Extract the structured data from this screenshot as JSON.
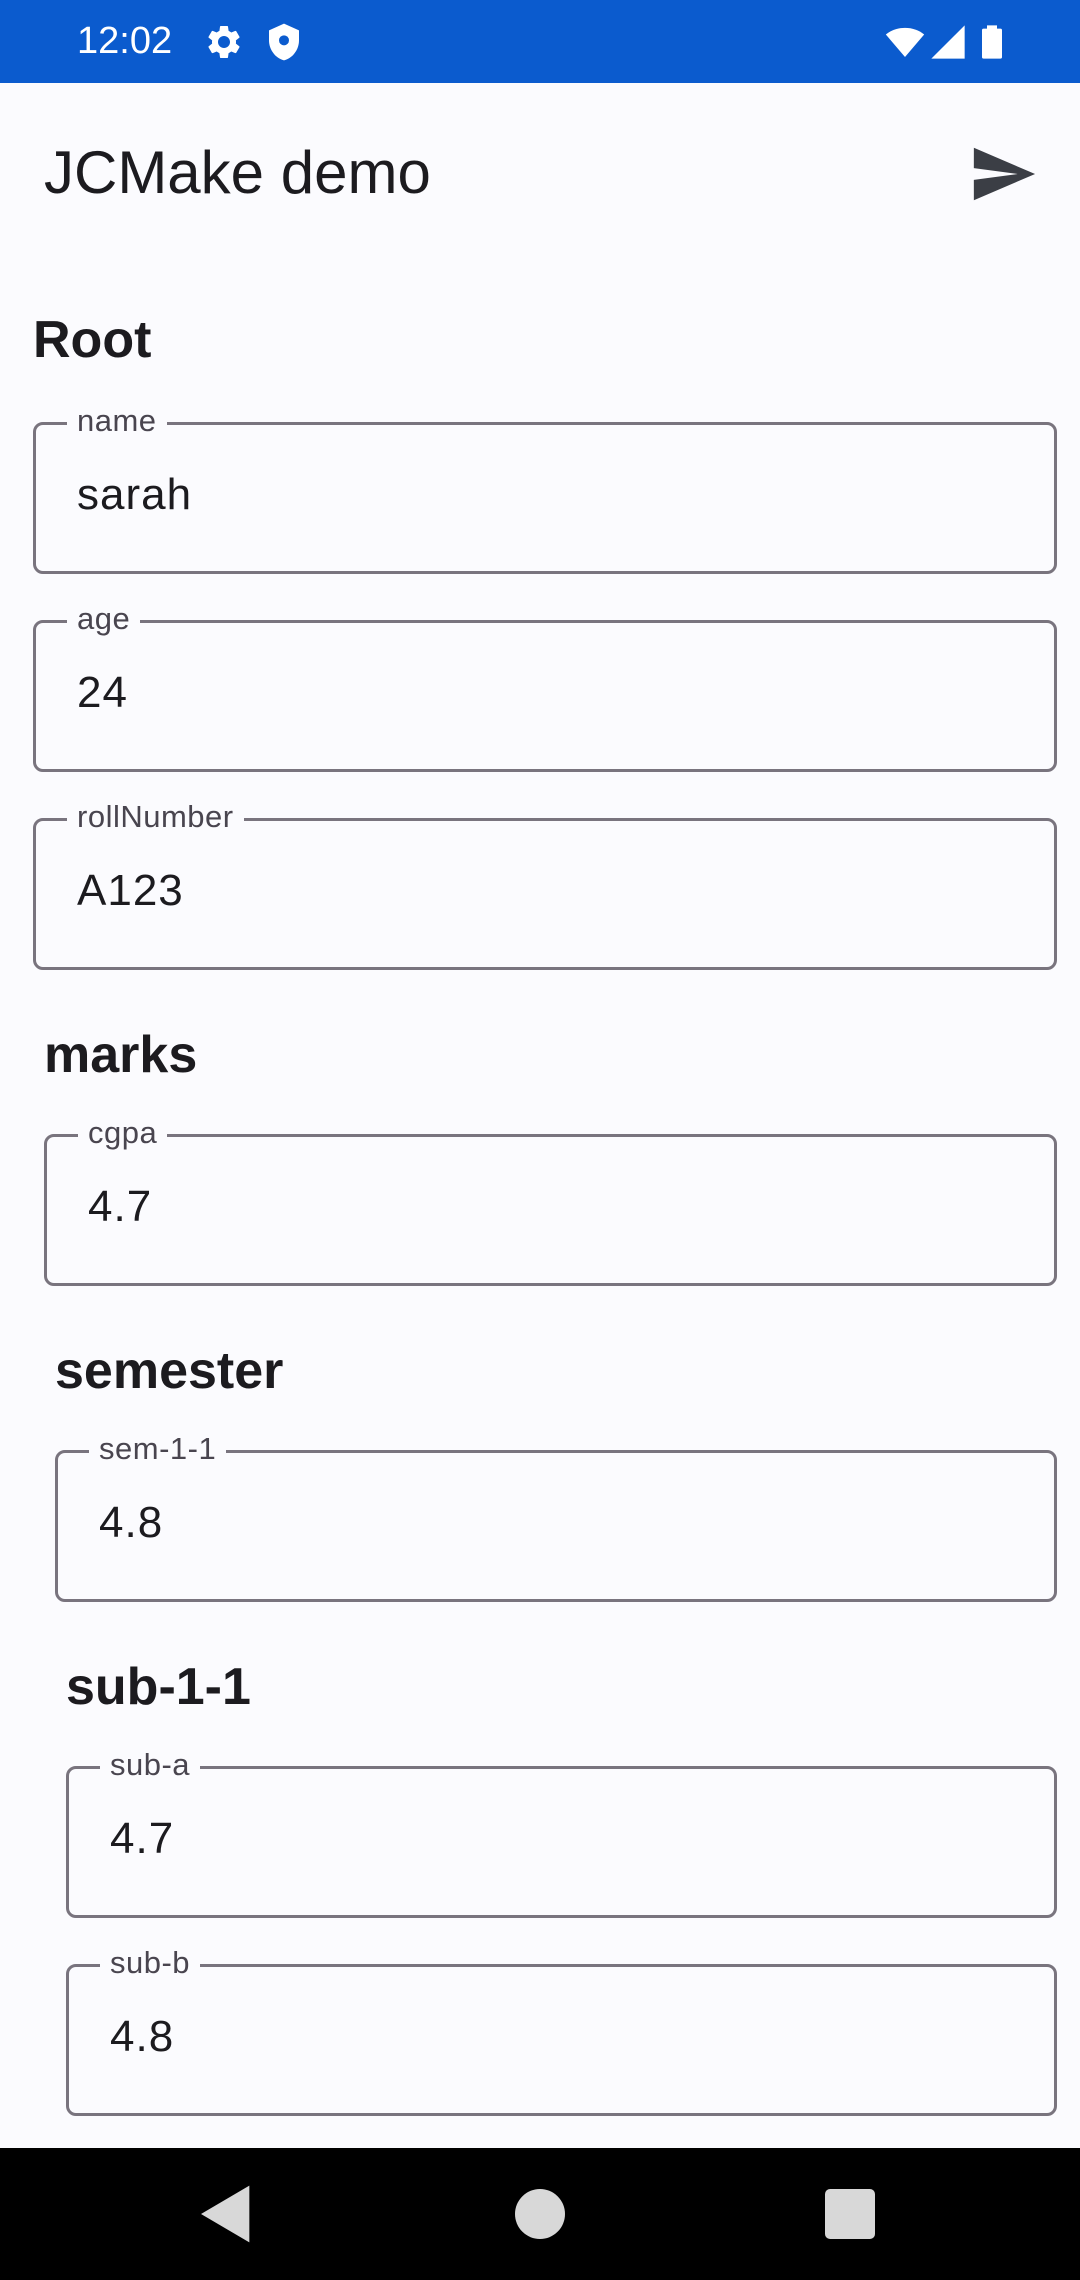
{
  "status_bar": {
    "time": "12:02",
    "icons": [
      "settings-icon",
      "shield-icon",
      "wifi-icon",
      "signal-icon",
      "battery-icon"
    ],
    "background": "#0b5bce"
  },
  "app_bar": {
    "title": "JCMake demo",
    "action_icon": "send-icon"
  },
  "form": {
    "root": {
      "title": "Root",
      "fields": [
        {
          "label": "name",
          "value": "sarah"
        },
        {
          "label": "age",
          "value": "24"
        },
        {
          "label": "rollNumber",
          "value": "A123"
        }
      ]
    },
    "marks": {
      "title": "marks",
      "fields": [
        {
          "label": "cgpa",
          "value": "4.7"
        }
      ]
    },
    "semester": {
      "title": "semester",
      "fields": [
        {
          "label": "sem-1-1",
          "value": "4.8"
        }
      ]
    },
    "sub_1_1": {
      "title": "sub-1-1",
      "fields": [
        {
          "label": "sub-a",
          "value": "4.7"
        },
        {
          "label": "sub-b",
          "value": "4.8"
        }
      ]
    }
  },
  "nav_bar": {
    "icons": [
      "back-icon",
      "home-icon",
      "recents-icon"
    ]
  }
}
